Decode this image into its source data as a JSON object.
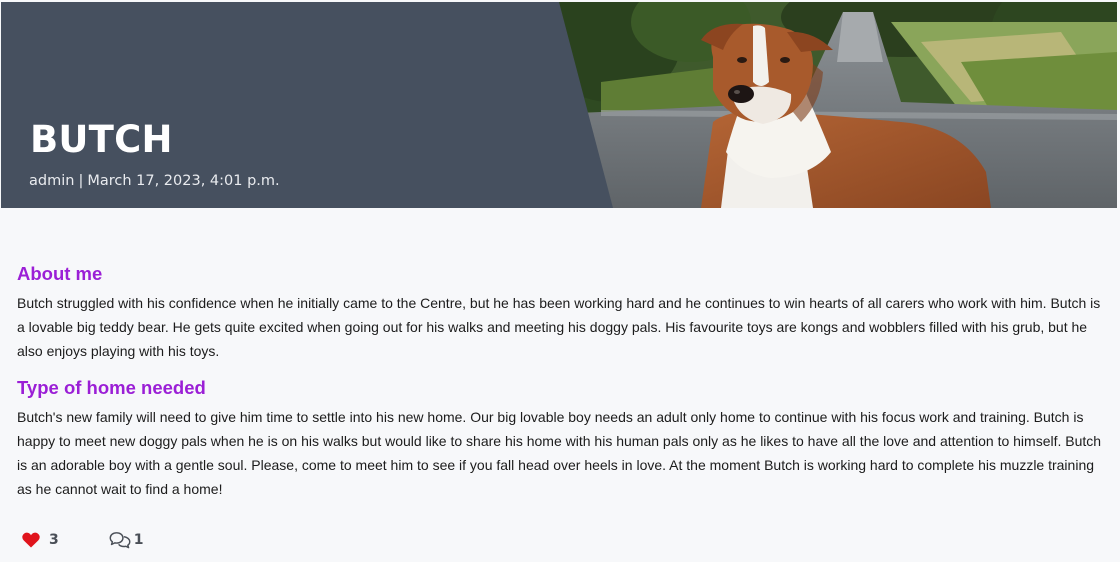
{
  "post": {
    "title": "BUTCH",
    "author": "admin",
    "separator": "|",
    "date": "March 17, 2023, 4:01 p.m."
  },
  "sections": [
    {
      "heading": "About me",
      "body": "Butch struggled with his confidence when he initially came to the Centre, but he has been working hard and he continues to win hearts of all carers who work with him. Butch is a lovable big teddy bear. He gets quite excited when going out for his walks and meeting his doggy pals. His favourite toys are kongs and wobblers filled with his grub, but he also enjoys playing with his toys."
    },
    {
      "heading": "Type of home needed",
      "body": "Butch's new family will need to give him time to settle into his new home. Our big lovable boy needs an adult only home to continue with his focus work and training. Butch is happy to meet new doggy pals when he is on his walks but would like to share his home with his human pals only as he likes to have all the love and attention to himself. Butch is an adorable boy with a gentle soul. Please, come to meet him to see if you fall head over heels in love. At the moment Butch is working hard to complete his muzzle training as he cannot wait to find a home!"
    }
  ],
  "reactions": {
    "likes": "3",
    "like_icon": "heart-icon",
    "comments": "1",
    "comment_icon": "comments-icon"
  },
  "colors": {
    "hero_panel": "#46505f",
    "heading_accent": "#9b1fd6",
    "like_heart": "#e0141c"
  }
}
